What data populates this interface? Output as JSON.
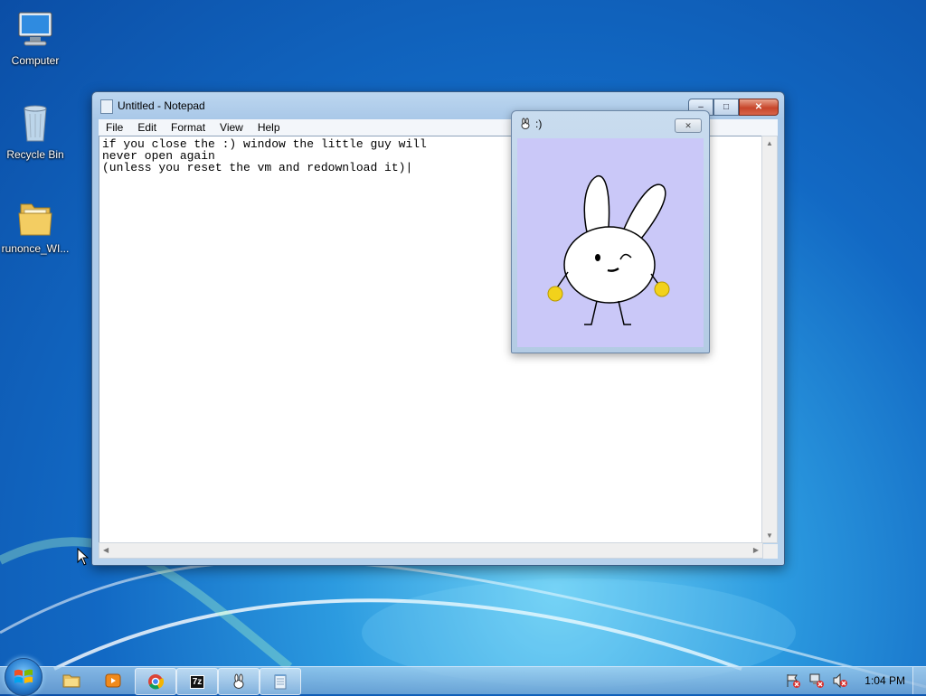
{
  "desktop": {
    "icons": [
      {
        "label": "Computer"
      },
      {
        "label": "Recycle Bin"
      },
      {
        "label": "runonce_WI..."
      }
    ]
  },
  "notepad": {
    "title": "Untitled - Notepad",
    "menu": [
      "File",
      "Edit",
      "Format",
      "View",
      "Help"
    ],
    "content": "if you close the :) window the little guy will\nnever open again\n(unless you reset the vm and redownload it)|",
    "buttons": {
      "minimize": "–",
      "maximize": "□",
      "close": "✕"
    }
  },
  "smiley_window": {
    "title": ":)",
    "close": "✕",
    "colors": {
      "background": "#cac8f8",
      "hands": "#f2d21b"
    }
  },
  "taskbar": {
    "apps": [
      {
        "icon": "explorer-icon"
      },
      {
        "icon": "media-player-icon"
      },
      {
        "icon": "chrome-icon"
      },
      {
        "icon": "7zip-icon",
        "label": "7z"
      },
      {
        "icon": "bunny-icon"
      },
      {
        "icon": "notepad-icon"
      }
    ],
    "clock": "1:04 PM"
  }
}
